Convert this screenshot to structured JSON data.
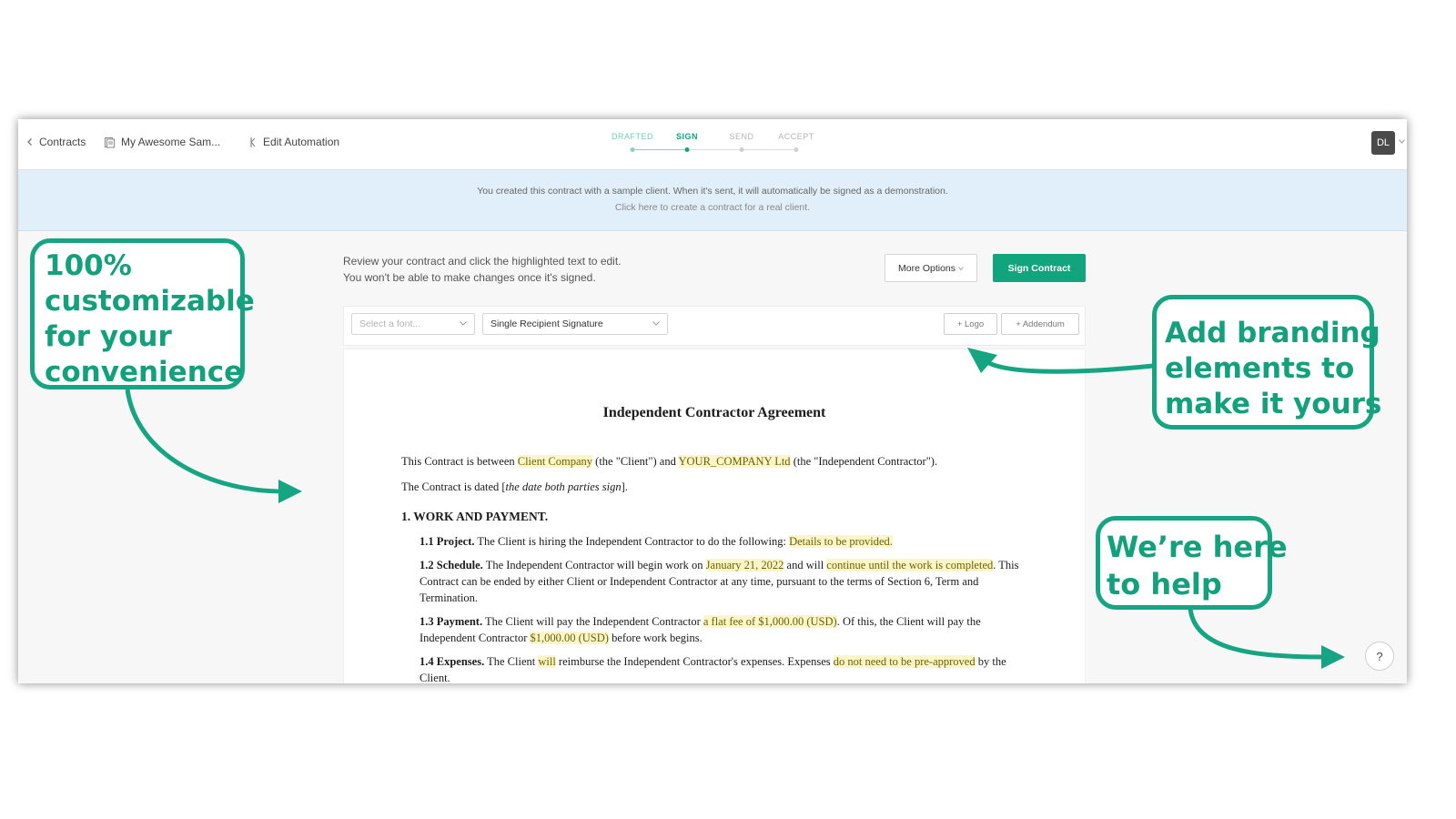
{
  "nav": {
    "back_label": "Contracts",
    "doc_name": "My Awesome Sam...",
    "automation_label": "Edit Automation",
    "avatar": "DL"
  },
  "steps": [
    {
      "label": "DRAFTED",
      "state": "done"
    },
    {
      "label": "SIGN",
      "state": "active"
    },
    {
      "label": "SEND",
      "state": "todo"
    },
    {
      "label": "ACCEPT",
      "state": "todo"
    }
  ],
  "banner": {
    "line1": "You created this contract with a sample client. When it's sent, it will automatically be signed as a demonstration.",
    "line2": "Click here to create a contract for a real client."
  },
  "instructions": {
    "line1": "Review your contract and click the highlighted text to edit.",
    "line2": "You won't be able to make changes once it's signed."
  },
  "actions": {
    "more_options": "More Options",
    "sign_contract": "Sign Contract"
  },
  "toolbar": {
    "font_placeholder": "Select a font...",
    "signature_type": "Single Recipient Signature",
    "logo_label": "+ Logo",
    "addendum_label": "+ Addendum"
  },
  "document": {
    "title": "Independent Contractor Agreement",
    "intro": {
      "p1": "This Contract is between ",
      "client": "Client Company",
      "p2": " (the \"Client\") and ",
      "company": "YOUR_COMPANY Ltd",
      "p3": " (the \"Independent Contractor\")."
    },
    "dated": {
      "p1": "The Contract is dated [",
      "date": "the date both parties sign",
      "p2": "]."
    },
    "section1": "1. WORK AND PAYMENT.",
    "c11": {
      "head": "1.1 Project.",
      "text": " The Client is hiring the Independent Contractor to do the following: ",
      "hl": "Details to be provided."
    },
    "c12": {
      "head": "1.2 Schedule.",
      "t1": " The Independent Contractor will begin work on ",
      "hl1": "January 21, 2022",
      "t2": " and will ",
      "hl2": "continue until the work is completed",
      "t3": ". This Contract can be ended by either Client or Independent Contractor at any time, pursuant to the terms of Section 6, Term and Termination."
    },
    "c13": {
      "head": "1.3 Payment.",
      "t1": " The Client will pay the Independent Contractor ",
      "hl1": "a flat fee of $1,000.00 (USD)",
      "t2": ". Of this, the Client will pay the Independent Contractor ",
      "hl2": "$1,000.00 (USD)",
      "t3": " before work begins."
    },
    "c14": {
      "head": "1.4 Expenses.",
      "t1": " The Client ",
      "hl1": "will",
      "t2": " reimburse the Independent Contractor's expenses. Expenses ",
      "hl2": "do not need to be pre-approved",
      "t3": " by the Client."
    }
  },
  "help": "?",
  "callouts": {
    "customizable": [
      "100%",
      "customizable",
      "for your",
      "convenience"
    ],
    "branding": [
      "Add branding",
      "elements to",
      "make it yours"
    ],
    "help": [
      "We’re here",
      "to help"
    ]
  },
  "colors": {
    "accent": "#10a57c",
    "callout": "#16a582",
    "highlight": "#fbf6c9",
    "banner": "#e1effa"
  }
}
